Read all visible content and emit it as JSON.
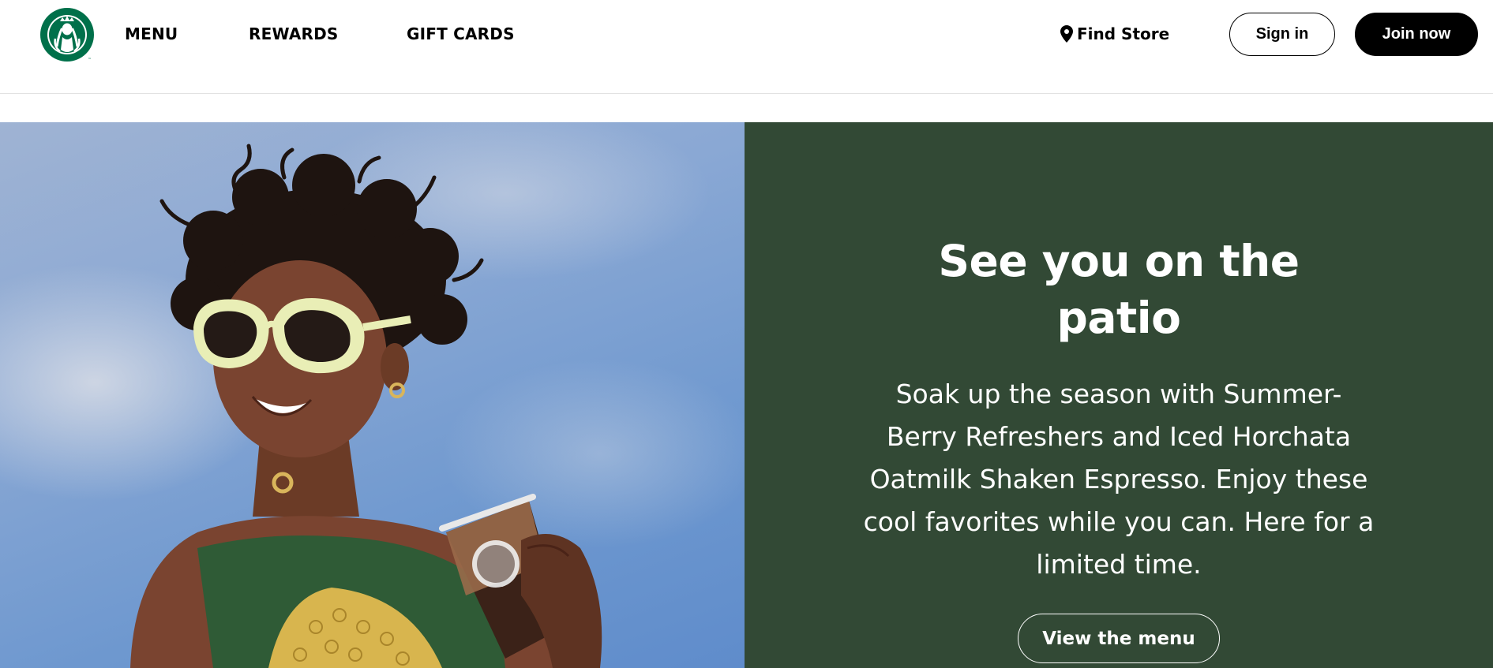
{
  "header": {
    "logo_icon": "starbucks-siren-logo",
    "brand_color": "#00704A",
    "nav": {
      "menu": "MENU",
      "rewards": "REWARDS",
      "gift_cards": "GIFT CARDS"
    },
    "find_store": {
      "label": "Find Store",
      "icon": "location-pin-icon"
    },
    "sign_in": "Sign in",
    "join_now": "Join now"
  },
  "hero": {
    "title_lines": [
      "See you on the",
      "patio"
    ],
    "body_lines": [
      "Soak up the season with Summer-",
      "Berry Refreshers and Iced Horchata",
      "Oatmilk Shaken Espresso. Enjoy these",
      "cool favorites while you can. Here for a",
      "limited time."
    ],
    "cta": "View the menu",
    "panel_color": "#324935",
    "image": "woman-sunglasses-iced-drink-photo"
  }
}
